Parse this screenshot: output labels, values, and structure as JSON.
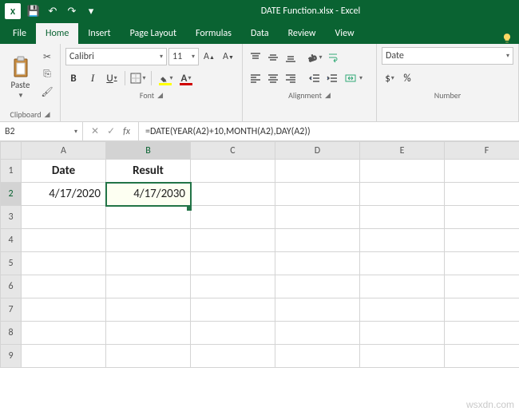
{
  "title": "DATE Function.xlsx - Excel",
  "qat": {
    "save": "💾",
    "undo": "↶",
    "redo": "↷"
  },
  "tabs": [
    "File",
    "Home",
    "Insert",
    "Page Layout",
    "Formulas",
    "Data",
    "Review",
    "View"
  ],
  "active_tab": "Home",
  "tell_icon": "💡",
  "ribbon": {
    "clipboard": {
      "paste": "Paste",
      "title": "Clipboard"
    },
    "font": {
      "name": "Calibri",
      "size": "11",
      "title": "Font"
    },
    "alignment": {
      "wrap": "W",
      "merge": "M",
      "title": "Alignment"
    },
    "number": {
      "format": "Date",
      "title": "Number"
    }
  },
  "name_box": "B2",
  "formula": "=DATE(YEAR(A2)+10,MONTH(A2),DAY(A2))",
  "cols": [
    "A",
    "B",
    "C",
    "D",
    "E",
    "F"
  ],
  "rows": [
    "1",
    "2",
    "3",
    "4",
    "5",
    "6",
    "7",
    "8",
    "9"
  ],
  "cells": {
    "A1": "Date",
    "B1": "Result",
    "A2": "4/17/2020",
    "B2": "4/17/2030"
  },
  "chart_data": {
    "type": "table",
    "columns": [
      "Date",
      "Result"
    ],
    "rows": [
      [
        "4/17/2020",
        "4/17/2030"
      ]
    ]
  },
  "watermark": "wsxdn.com"
}
